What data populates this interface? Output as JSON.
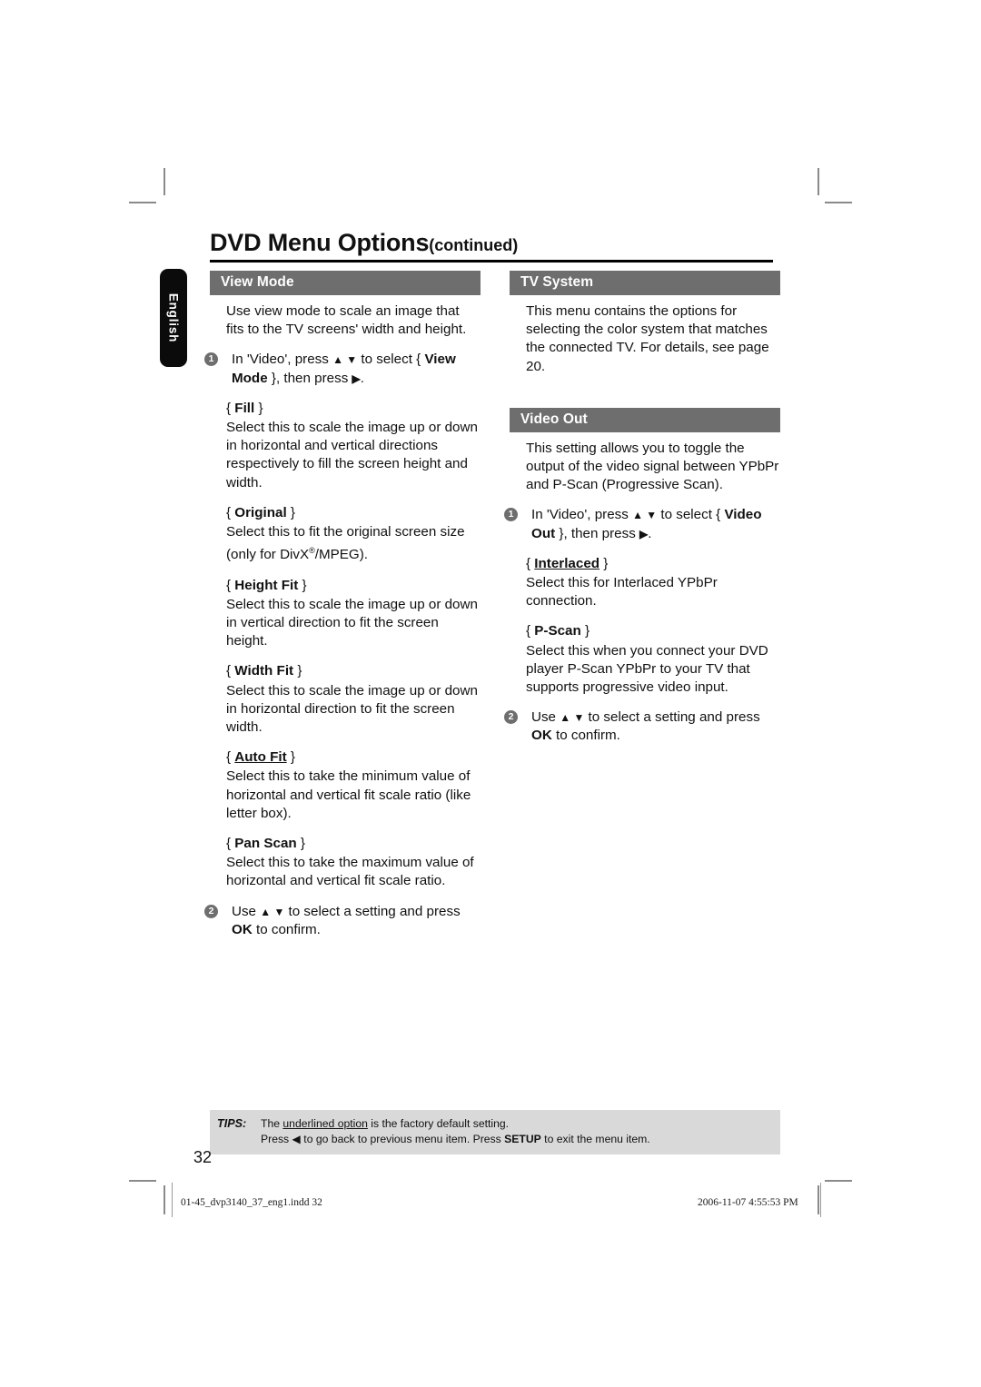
{
  "page": {
    "title_main": "DVD Menu Options",
    "title_suffix": "(continued)",
    "language_tab": "English",
    "page_number": "32"
  },
  "left_column": {
    "sections": [
      {
        "header": "View Mode",
        "intro": "Use view mode to scale an image that fits to the TV screens' width and height.",
        "step1_number": "1",
        "step1_pre": "In 'Video', press ",
        "step1_arrows": "▲ ▼",
        "step1_mid": " to select { ",
        "step1_bold": "View Mode",
        "step1_post": " }, then press ",
        "step1_arrow_right": "▶",
        "step1_end": ".",
        "options": [
          {
            "name": "Fill",
            "underlined": false,
            "desc": "Select this to scale the image up or down in horizontal and vertical directions respectively to fill the screen height and width."
          },
          {
            "name": "Original",
            "underlined": false,
            "desc": "Select this to fit the original screen size (only for DivX®/MPEG)."
          },
          {
            "name": "Height Fit",
            "underlined": false,
            "desc": "Select this to scale the image up or down in vertical direction to fit the screen height."
          },
          {
            "name": "Width Fit",
            "underlined": false,
            "desc": "Select this to scale the image up or down in horizontal direction to fit the screen width."
          },
          {
            "name": "Auto Fit",
            "underlined": true,
            "desc": "Select this to take the minimum value of horizontal and vertical fit scale ratio (like letter box)."
          },
          {
            "name": "Pan Scan",
            "underlined": false,
            "desc": "Select this to take the maximum value of horizontal and vertical fit scale ratio."
          }
        ],
        "step2_number": "2",
        "step2_pre": "Use ",
        "step2_arrows": "▲ ▼",
        "step2_mid": " to select a setting and press ",
        "step2_bold": "OK",
        "step2_post": " to confirm."
      }
    ]
  },
  "right_column": {
    "sections": [
      {
        "header": "TV System",
        "intro": "This menu contains the options for selecting the color system that matches the connected TV. For details, see page 20."
      },
      {
        "header": "Video Out",
        "intro": "This setting allows you to toggle the output of the video signal between YPbPr and P-Scan (Progressive Scan).",
        "step1_number": "1",
        "step1_pre": "In 'Video', press ",
        "step1_arrows": "▲ ▼",
        "step1_mid": " to select { ",
        "step1_bold": "Video Out",
        "step1_post": " }, then press ",
        "step1_arrow_right": "▶",
        "step1_end": ".",
        "options": [
          {
            "name": "Interlaced",
            "underlined": true,
            "desc": "Select this for Interlaced YPbPr connection."
          },
          {
            "name": "P-Scan",
            "underlined": false,
            "desc": "Select this when you connect your DVD player P-Scan YPbPr to your TV that supports progressive video input."
          }
        ],
        "step2_number": "2",
        "step2_pre": "Use ",
        "step2_arrows": "▲ ▼",
        "step2_mid": " to select a setting and press ",
        "step2_bold": "OK",
        "step2_post": " to confirm."
      }
    ]
  },
  "tips": {
    "label": "TIPS:",
    "line1_pre": "The ",
    "line1_underlined": "underlined option",
    "line1_post": " is the factory default setting.",
    "line2_pre": "Press ",
    "line2_arrow": "◀",
    "line2_mid": " to go back to previous menu item. Press ",
    "line2_bold": "SETUP",
    "line2_post": " to exit the menu item."
  },
  "footer": {
    "file_name": "01-45_dvp3140_37_eng1.indd   32",
    "timestamp": "2006-11-07   4:55:53 PM"
  },
  "colors": {
    "header_bar": "#6e6e6e",
    "tips_background": "#d9d9d9",
    "language_tab": "#0b0b0b",
    "bullet": "#6e6e6e"
  }
}
